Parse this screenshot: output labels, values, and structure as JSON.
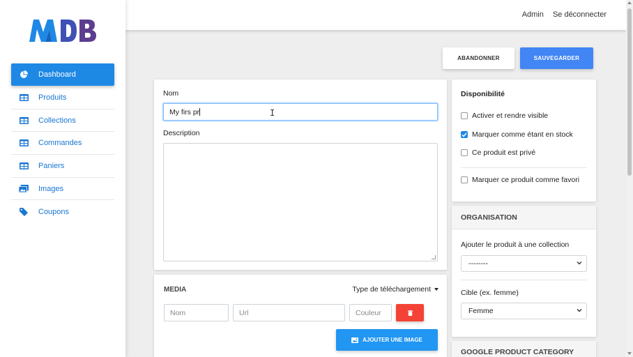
{
  "logo": {
    "text": "MDB",
    "colors": [
      "#1e88e5",
      "#3f51b5",
      "#5c3d8f"
    ]
  },
  "topbar": {
    "admin_label": "Admin",
    "logout_label": "Se déconnecter"
  },
  "sidebar": {
    "items": [
      {
        "label": "Dashboard",
        "icon": "pie-chart-icon",
        "active": true
      },
      {
        "label": "Produits",
        "icon": "table-icon"
      },
      {
        "label": "Collections",
        "icon": "table-icon"
      },
      {
        "label": "Commandes",
        "icon": "table-icon"
      },
      {
        "label": "Paniers",
        "icon": "table-icon"
      },
      {
        "label": "Images",
        "icon": "images-icon"
      },
      {
        "label": "Coupons",
        "icon": "tag-icon"
      }
    ]
  },
  "actions": {
    "abandon_label": "ABANDONNER",
    "save_label": "SAUVEGARDER"
  },
  "product_form": {
    "name_label": "Nom",
    "name_value": "My firs pr",
    "description_label": "Description",
    "description_value": ""
  },
  "media": {
    "title": "MEDIA",
    "upload_type_label": "Type de téléchargement",
    "name_placeholder": "Nom",
    "url_placeholder": "Url",
    "color_placeholder": "Couleur",
    "add_image_label": "AJOUTER UNE IMAGE"
  },
  "availability": {
    "title": "Disponibilité",
    "options": [
      {
        "label": "Activer et rendre visible",
        "checked": false
      },
      {
        "label": "Marquer comme étant en stock",
        "checked": true
      },
      {
        "label": "Ce produit est privé",
        "checked": false
      },
      {
        "label": "Marquer ce produit comme favori",
        "checked": false
      }
    ]
  },
  "organisation": {
    "title": "ORGANISATION",
    "collection_label": "Ajouter le produit à une collection",
    "collection_value": "--------",
    "target_label": "Cible (ex. femme)",
    "target_value": "Femme"
  },
  "google_category": {
    "title": "GOOGLE PRODUCT CATEGORY"
  },
  "colors": {
    "primary": "#1e88e5",
    "save": "#4285f4",
    "danger": "#f44336",
    "add_image": "#2196f3"
  }
}
